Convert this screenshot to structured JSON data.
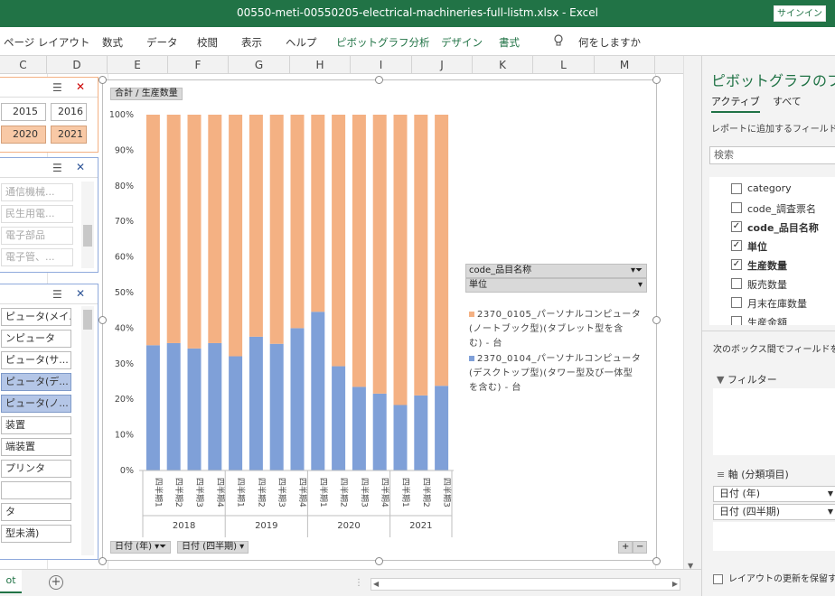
{
  "window": {
    "title": "00550-meti-00550205-electrical-machineries-full-listm.xlsx  -  Excel",
    "signin": "サインイン"
  },
  "ribbon": {
    "tabs": [
      "ページ レイアウト",
      "数式",
      "データ",
      "校閲",
      "表示",
      "ヘルプ",
      "ピボットグラフ分析",
      "デザイン",
      "書式"
    ],
    "tell_me": "何をしますか"
  },
  "columns": [
    "C",
    "D",
    "E",
    "F",
    "G",
    "H",
    "I",
    "J",
    "K",
    "L",
    "M"
  ],
  "slicers": {
    "year": {
      "items": [
        "2015",
        "2016",
        "2020",
        "2021"
      ]
    },
    "category": {
      "items": [
        "通信機械...",
        "民生用電...",
        "電子部品",
        "電子管、...",
        "..."
      ]
    },
    "item": {
      "items": [
        "ピュータ(メイ...",
        "ンピュータ",
        "ピュータ(サ...",
        "ピュータ(デ...",
        "ピュータ(ノ...",
        "装置",
        "端装置",
        "プリンタ",
        "",
        "タ",
        "型未満)"
      ]
    }
  },
  "chart": {
    "value_button": "合計 / 生産数量",
    "axis_button_1": "日付 (年)",
    "axis_button_2": "日付 (四半期)",
    "legend_head_1": "code_品目名称",
    "legend_head_2": "単位",
    "legend_item_1": "2370_0105_パーソナルコンピュータ\n(ノートブック型)(タブレット型を含\nむ) - 台",
    "legend_item_2": "2370_0104_パーソナルコンピュータ\n(デスクトップ型)(タワー型及び一体型\nを含む) - 台",
    "zoom_plus": "+",
    "zoom_minus": "−"
  },
  "chart_data": {
    "type": "bar",
    "stacked": "percent",
    "ylim": [
      0,
      100
    ],
    "yticks": [
      "0%",
      "10%",
      "20%",
      "30%",
      "40%",
      "50%",
      "60%",
      "70%",
      "80%",
      "90%",
      "100%"
    ],
    "quarters": [
      "四半期1",
      "四半期2",
      "四半期3",
      "四半期4",
      "四半期1",
      "四半期2",
      "四半期3",
      "四半期4",
      "四半期1",
      "四半期2",
      "四半期3",
      "四半期4",
      "四半期1",
      "四半期2",
      "四半期3"
    ],
    "years": [
      {
        "label": "2018",
        "count": 4
      },
      {
        "label": "2019",
        "count": 4
      },
      {
        "label": "2020",
        "count": 4
      },
      {
        "label": "2021",
        "count": 3
      }
    ],
    "series": [
      {
        "name": "2370_0104_パーソナルコンピュータ(デスクトップ型)(タワー型及び一体型を含む) - 台",
        "color": "#7fa0d8",
        "values": [
          35.2,
          35.8,
          34.3,
          35.8,
          32.1,
          37.6,
          35.6,
          40.0,
          44.6,
          29.3,
          23.5,
          21.6,
          18.4,
          21.1,
          23.8
        ]
      },
      {
        "name": "2370_0105_パーソナルコンピュータ(ノートブック型)(タブレット型を含む) - 台",
        "color": "#f4b183",
        "values": [
          64.8,
          64.2,
          65.7,
          64.2,
          67.9,
          62.4,
          64.4,
          60.0,
          55.4,
          70.7,
          76.5,
          78.4,
          81.6,
          78.9,
          76.2
        ]
      }
    ]
  },
  "fieldpane": {
    "title": "ピボットグラフのフィ",
    "tab_active": "アクティブ",
    "tab_all": "すべて",
    "hint": "レポートに追加するフィールドを選",
    "search": "検索",
    "fields": [
      {
        "label": "category",
        "checked": false
      },
      {
        "label": "code_調査票名",
        "checked": false
      },
      {
        "label": "code_品目名称",
        "checked": true
      },
      {
        "label": "単位",
        "checked": true
      },
      {
        "label": "生産数量",
        "checked": true
      },
      {
        "label": "販売数量",
        "checked": false
      },
      {
        "label": "月末在庫数量",
        "checked": false
      },
      {
        "label": "生産金額",
        "checked": false
      }
    ],
    "drag_hint": "次のボックス間でフィールドをドラ",
    "filter_label": "フィルター",
    "axis_label": "軸 (分類項目)",
    "axis_fields": [
      "日付 (年)",
      "日付 (四半期)"
    ],
    "defer_label": "レイアウトの更新を保留する"
  },
  "sheetbar": {
    "tab": "ot",
    "add": "+"
  }
}
